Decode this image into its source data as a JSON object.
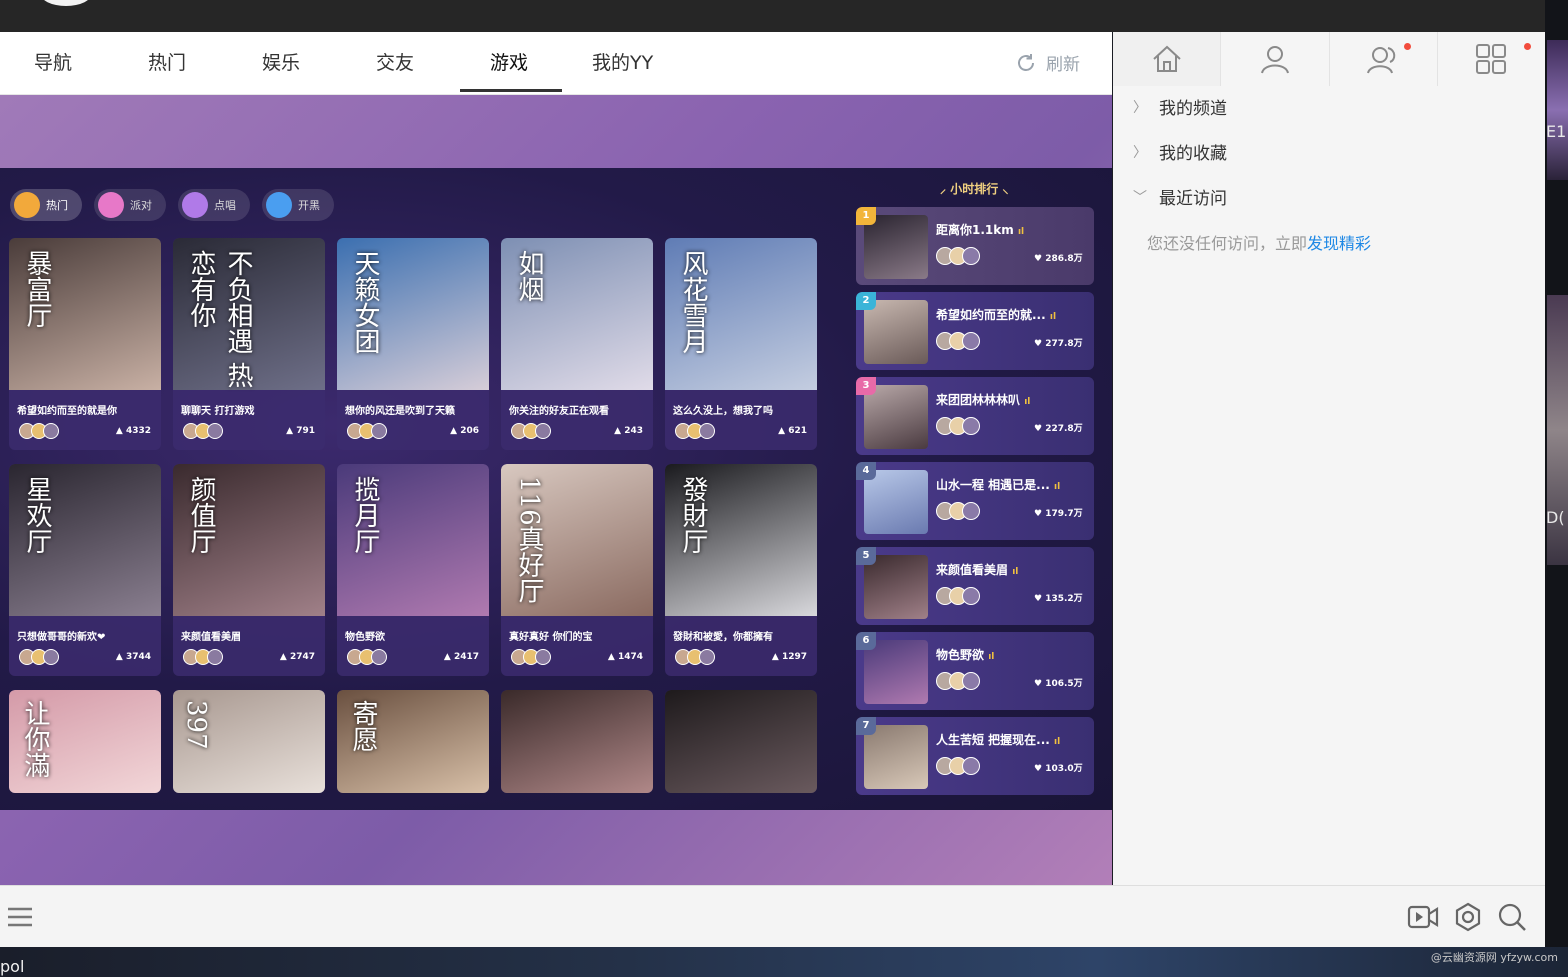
{
  "tabs": [
    {
      "label": "导航"
    },
    {
      "label": "热门"
    },
    {
      "label": "娱乐"
    },
    {
      "label": "交友"
    },
    {
      "label": "游戏"
    },
    {
      "label": "我的YY"
    }
  ],
  "active_tab": "游戏",
  "refresh_label": "刷新",
  "chips": [
    {
      "label": "热门",
      "color": "#f2a93b"
    },
    {
      "label": "派对",
      "color": "#e778c8"
    },
    {
      "label": "点唱",
      "color": "#b07ae8"
    },
    {
      "label": "开黑",
      "color": "#4a9ef0"
    }
  ],
  "cards": [
    {
      "title": "希望如约而至的就是你",
      "count": "4332",
      "overlay": "暴富厅",
      "bg": [
        "#4a3c3a",
        "#c8b0a4"
      ]
    },
    {
      "title": "聊聊天 打打游戏",
      "count": "791",
      "overlay": "不负相遇 热恋有你",
      "bg": [
        "#2a2a36",
        "#6e6f88"
      ]
    },
    {
      "title": "想你的风还是吹到了天籁",
      "count": "206",
      "overlay": "天籁女团",
      "bg": [
        "#3b6fb0",
        "#d6cdd8"
      ]
    },
    {
      "title": "你关注的好友正在观看",
      "count": "243",
      "overlay": "如烟",
      "bg": [
        "#7d8fb3",
        "#e0dbe8"
      ]
    },
    {
      "title": "这么久没上，想我了吗",
      "count": "621",
      "overlay": "风花雪月",
      "bg": [
        "#5f7cb5",
        "#c4cde0"
      ]
    },
    {
      "title": "只想做哥哥的新欢❤",
      "count": "3744",
      "overlay": "星欢厅",
      "bg": [
        "#2a2630",
        "#8a7f90"
      ]
    },
    {
      "title": "来颜值看美眉",
      "count": "2747",
      "overlay": "颜值厅",
      "bg": [
        "#3a2a2e",
        "#a08088"
      ]
    },
    {
      "title": "物色野欲",
      "count": "2417",
      "overlay": "揽月厅",
      "bg": [
        "#4a3a7a",
        "#b07ab0"
      ]
    },
    {
      "title": "真好真好 你们的宝",
      "count": "1474",
      "overlay": "116真好厅",
      "bg": [
        "#d8c8c0",
        "#8a6a60"
      ]
    },
    {
      "title": "發財和被愛，你都擁有",
      "count": "1297",
      "overlay": "發財厅",
      "bg": [
        "#1a1a1e",
        "#d8d8dc"
      ]
    }
  ],
  "partial_cards": [
    {
      "overlay": "让你滿",
      "bg": [
        "#d49aa8",
        "#f2d6d8"
      ]
    },
    {
      "overlay": "397",
      "bg": [
        "#a89890",
        "#e8e0da"
      ]
    },
    {
      "overlay": "寄愿",
      "bg": [
        "#6a5040",
        "#d8c0a8"
      ]
    },
    {
      "overlay": "",
      "bg": [
        "#3a2a2a",
        "#b08888"
      ]
    },
    {
      "overlay": "",
      "bg": [
        "#1e1a1c",
        "#6a5a5e"
      ]
    }
  ],
  "rank_title": "小时排行",
  "ranks": [
    {
      "num": "1",
      "name": "距离你1.1km",
      "hot": "286.8万",
      "num_color": "#f2b53a",
      "thumb": [
        "#2a2430",
        "#8a7a88"
      ]
    },
    {
      "num": "2",
      "name": "希望如约而至的就...",
      "hot": "277.8万",
      "num_color": "#3ab4d8",
      "thumb": [
        "#c8b8b0",
        "#6a5a58"
      ]
    },
    {
      "num": "3",
      "name": "来团团林林林叭",
      "hot": "227.8万",
      "num_color": "#e86aa8",
      "thumb": [
        "#b8a8a8",
        "#4a3a40"
      ]
    },
    {
      "num": "4",
      "name": "山水一程 相遇已是...",
      "hot": "179.7万",
      "num_color": "#5a6a9a",
      "thumb": [
        "#b8c8e8",
        "#6a7ab0"
      ]
    },
    {
      "num": "5",
      "name": "来颜值看美眉",
      "hot": "135.2万",
      "num_color": "#5a6a9a",
      "thumb": [
        "#3a2a2e",
        "#a08088"
      ]
    },
    {
      "num": "6",
      "name": "物色野欲",
      "hot": "106.5万",
      "num_color": "#5a6a9a",
      "thumb": [
        "#4a3a7a",
        "#b07ab0"
      ]
    },
    {
      "num": "7",
      "name": "人生苦短 把握现在...",
      "hot": "103.0万",
      "num_color": "#5a6a9a",
      "thumb": [
        "#8a7a70",
        "#d8c8b8"
      ]
    }
  ],
  "sidebar": {
    "my_channels": "我的频道",
    "my_favorites": "我的收藏",
    "recent_visits": "最近访问",
    "empty_text": "您还没任何访问，立即",
    "empty_link": "发现精彩"
  },
  "watermark": "@云幽资源网 yfzyw.com",
  "bottom_left_text": "pol"
}
